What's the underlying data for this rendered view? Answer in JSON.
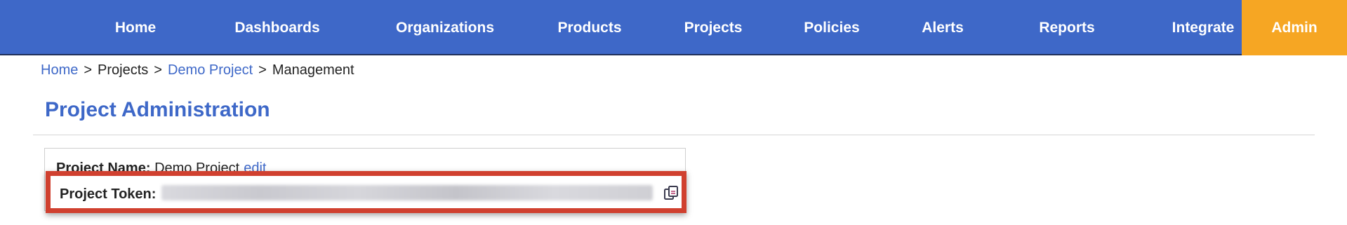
{
  "nav": {
    "items": [
      {
        "label": "Home"
      },
      {
        "label": "Dashboards"
      },
      {
        "label": "Organizations"
      },
      {
        "label": "Products"
      },
      {
        "label": "Projects"
      },
      {
        "label": "Policies"
      },
      {
        "label": "Alerts"
      },
      {
        "label": "Reports"
      },
      {
        "label": "Integrate"
      }
    ],
    "admin_label": "Admin",
    "colors": {
      "bar": "#3e68c8",
      "admin": "#f6a623"
    }
  },
  "breadcrumb": {
    "items": [
      "Home",
      "Projects",
      "Demo Project",
      "Management"
    ],
    "separator": ">"
  },
  "page": {
    "title": "Project Administration"
  },
  "project": {
    "name_label": "Project Name:",
    "name_value": "Demo Project",
    "edit_label": "edit",
    "token_label": "Project Token:",
    "token_value_redacted": "blurred"
  },
  "icons": {
    "copy": "copy-icon"
  },
  "highlight_color": "#d0402f"
}
